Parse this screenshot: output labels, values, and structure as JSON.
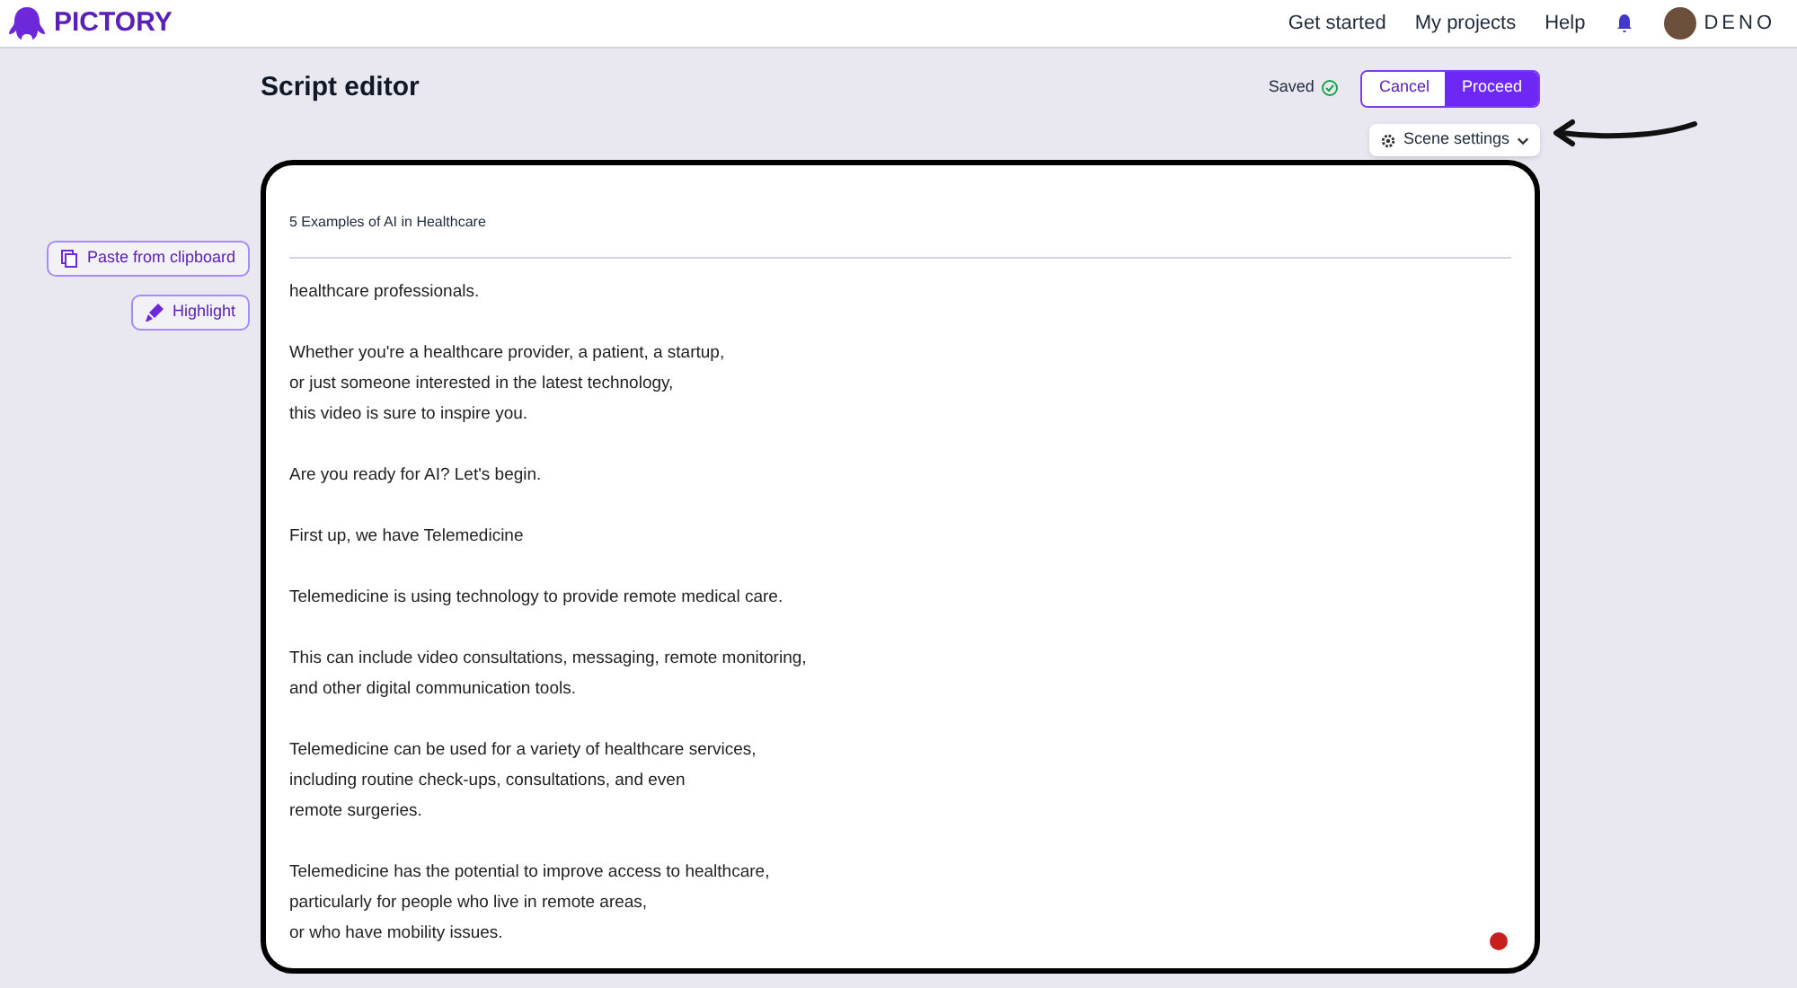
{
  "brand": "PICTORY",
  "nav": [
    {
      "label": "Get started"
    },
    {
      "label": "My projects"
    },
    {
      "label": "Help"
    }
  ],
  "user": {
    "name": "DENO"
  },
  "page_title": "Script editor",
  "save_status": "Saved",
  "buttons": [
    {
      "label": "Cancel",
      "kind": "outline"
    },
    {
      "label": "Proceed",
      "kind": "primary"
    }
  ],
  "scene_settings": "Scene settings",
  "side_buttons": [
    {
      "label": "Paste from clipboard",
      "kind": "paste"
    },
    {
      "label": "Highlight",
      "kind": "highlight"
    }
  ],
  "editor": {
    "title": "5 Examples of AI in Healthcare",
    "paragraphs": [
      [
        "healthcare professionals."
      ],
      [
        "Whether you're a healthcare provider, a patient, a startup,",
        "or just someone interested in the latest technology,",
        "this video is sure to inspire you."
      ],
      [
        "Are you ready for AI? Let's begin."
      ],
      [
        "First up, we have Telemedicine"
      ],
      [
        "Telemedicine is using technology to provide remote medical care."
      ],
      [
        "This can include video consultations, messaging, remote monitoring,",
        "and other digital communication tools."
      ],
      [
        "Telemedicine can be used for a variety of healthcare services,",
        "including routine check-ups, consultations, and even",
        "remote surgeries."
      ],
      [
        "Telemedicine has the potential to improve access to healthcare,",
        "particularly for people who live in remote areas,",
        "or who have mobility issues."
      ]
    ]
  }
}
